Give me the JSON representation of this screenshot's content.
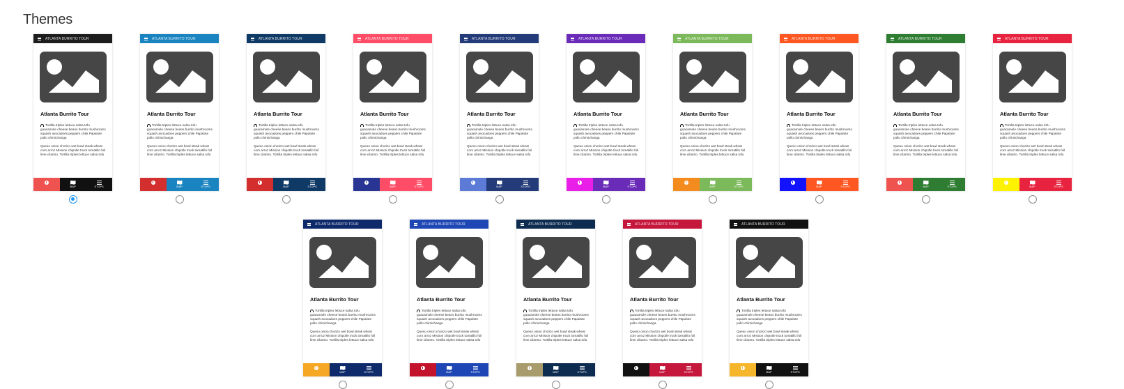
{
  "page": {
    "title": "Themes"
  },
  "preview": {
    "header_title": "ATLANTA BURRITO TOUR",
    "card_title": "Atlanta Burrito Tour",
    "desc_1": "Tortilla triples lettuce salsa tofu guacamole cheese beans burrito mushrooms squash avocadoes peppers chile Papalote pollo chimichanga",
    "desc_2": "Queso onion chorizo wet bowl steak wheat corn arroz Mission chipotle truck tomatillo foil lime cilantro. Tortilla triples lettuce salsa tofu",
    "tabs": {
      "info": "INFO",
      "map": "MAP",
      "stops": "STOPS"
    },
    "icons": {
      "menu": "hamburger-icon",
      "image": "image-placeholder-icon",
      "audio": "headphones-icon",
      "info": "info-icon",
      "map": "map-icon",
      "stops": "list-icon"
    }
  },
  "themes": [
    {
      "header": "#1d1d1d",
      "info": "#ef5350",
      "map": "#111111",
      "stops": "#111111",
      "selected": true
    },
    {
      "header": "#1a84c0",
      "info": "#d32f2f",
      "map": "#1a84c0",
      "stops": "#1a84c0",
      "selected": false
    },
    {
      "header": "#0f3a66",
      "info": "#d32f2f",
      "map": "#0f3a66",
      "stops": "#0f3a66",
      "selected": false
    },
    {
      "header": "#ff4d67",
      "info": "#283593",
      "map": "#ff4d67",
      "stops": "#ff4d67",
      "selected": false
    },
    {
      "header": "#233b78",
      "info": "#5c7bd6",
      "map": "#233b78",
      "stops": "#233b78",
      "selected": false
    },
    {
      "header": "#6a2cb8",
      "info": "#e91ee8",
      "map": "#6a2cb8",
      "stops": "#6a2cb8",
      "selected": false
    },
    {
      "header": "#7cb95a",
      "info": "#f48b1f",
      "map": "#7cb95a",
      "stops": "#7cb95a",
      "selected": false
    },
    {
      "header": "#ff5722",
      "info": "#1212ff",
      "map": "#ff5722",
      "stops": "#ff5722",
      "selected": false
    },
    {
      "header": "#2e7d32",
      "info": "#ef5350",
      "map": "#2e7d32",
      "stops": "#2e7d32",
      "selected": false
    },
    {
      "header": "#e8233f",
      "info": "#fff200",
      "map": "#e8233f",
      "stops": "#e8233f",
      "selected": false
    },
    {
      "header": "#0e2a6b",
      "info": "#f6a724",
      "map": "#0e2a6b",
      "stops": "#0e2a6b",
      "selected": false
    },
    {
      "header": "#1e47b5",
      "info": "#c3122b",
      "map": "#1e47b5",
      "stops": "#1e47b5",
      "selected": false
    },
    {
      "header": "#0d2c50",
      "info": "#a89b6c",
      "map": "#0d2c50",
      "stops": "#0d2c50",
      "selected": false
    },
    {
      "header": "#c5163b",
      "info": "#111111",
      "map": "#c5163b",
      "stops": "#c5163b",
      "selected": false
    },
    {
      "header": "#111111",
      "info": "#f6b62c",
      "map": "#111111",
      "stops": "#111111",
      "selected": false
    }
  ]
}
